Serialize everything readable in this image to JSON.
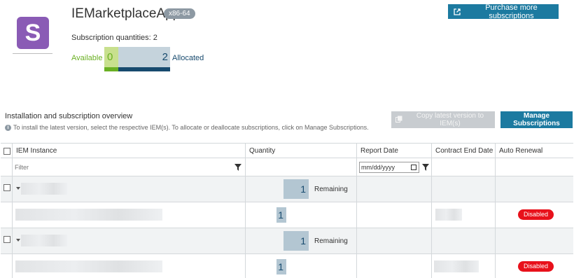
{
  "app": {
    "logo_letter": "S",
    "title": "IEMarketplaceApp",
    "arch_badge": "x86-64",
    "quantities_label": "Subscription quantities: 2",
    "available_label": "Available",
    "allocated_label": "Allocated",
    "available_count": "0",
    "allocated_count": "2"
  },
  "actions": {
    "purchase_label": "Purchase more subscriptions",
    "copy_label": "Copy latest version to IEM(s)",
    "manage_label": "Manage Subscriptions"
  },
  "overview": {
    "title": "Installation and subscription overview",
    "hint": "To install the latest version, select the respective IEM(s). To allocate or deallocate subscriptions, click on Manage Subscriptions."
  },
  "table": {
    "columns": [
      "IEM Instance",
      "Quantity",
      "Report Date",
      "Contract End Date",
      "Auto Renewal"
    ],
    "filter_placeholder": "Filter",
    "date_placeholder": "mm/dd/yyyy",
    "groups": [
      {
        "remaining_qty": "1",
        "remaining_label": "Remaining",
        "child_qty": "1",
        "auto_renewal": "Disabled"
      },
      {
        "remaining_qty": "1",
        "remaining_label": "Remaining",
        "child_qty": "1",
        "auto_renewal": "Disabled"
      }
    ]
  },
  "colors": {
    "accent": "#1c7aa0",
    "available": "#6ab023",
    "allocated": "#174a6e",
    "disabled": "#e8111b",
    "logo": "#8a5bb5"
  },
  "icons": [
    "external-link-icon",
    "info-icon",
    "copy-icon",
    "filter-icon",
    "calendar-icon",
    "expand-caret-icon"
  ]
}
